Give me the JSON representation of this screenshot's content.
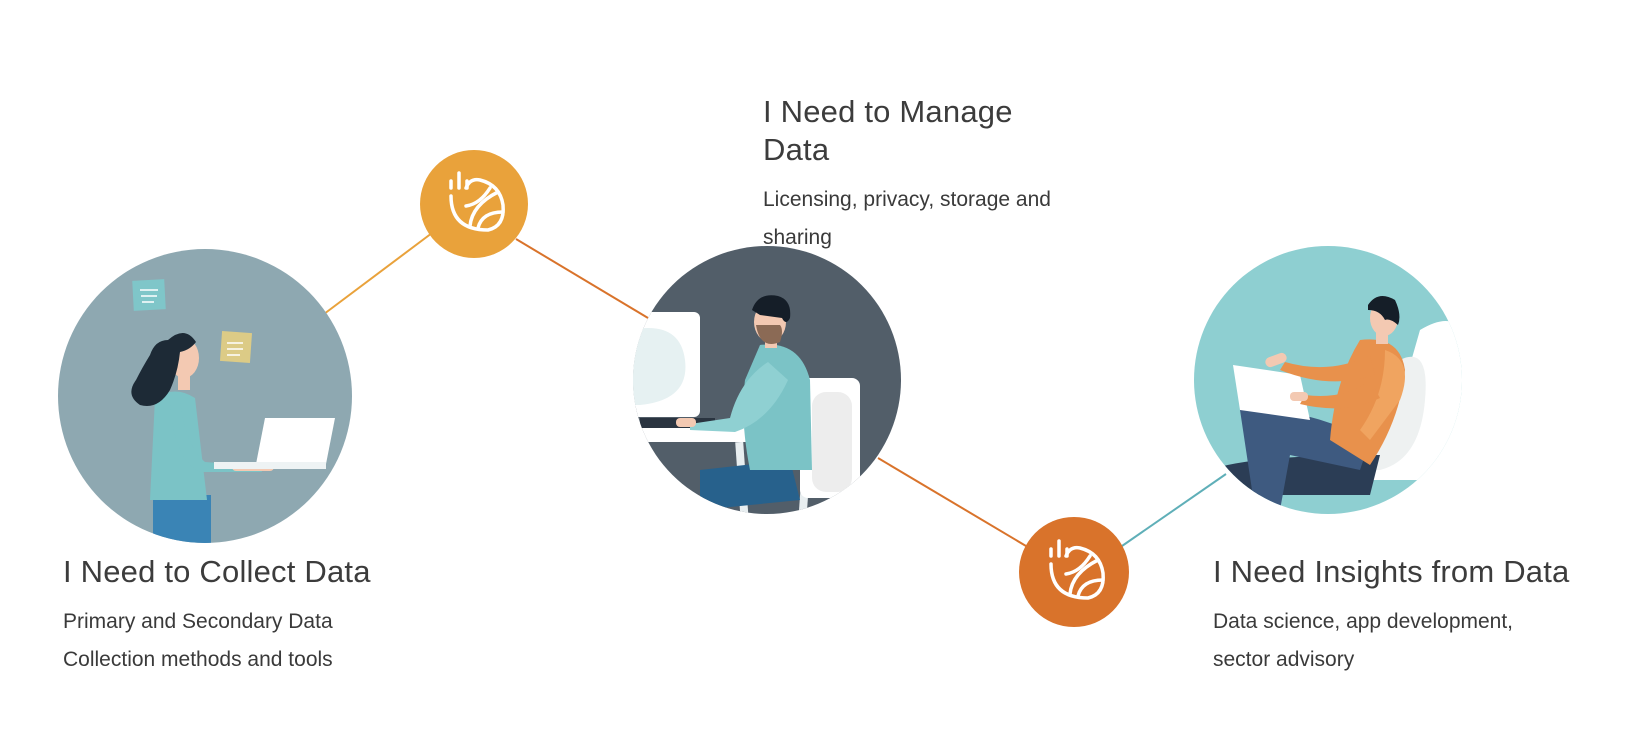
{
  "steps": [
    {
      "title": "I Need to Collect Data",
      "description_line1": "Primary and Secondary Data",
      "description_line2": "Collection methods and tools",
      "illustration": "woman-with-laptop-illustration"
    },
    {
      "title": "I Need to Manage Data",
      "description_line1": "Licensing, privacy, storage and",
      "description_line2": "sharing",
      "illustration": "man-at-desk-computer-illustration"
    },
    {
      "title": "I Need Insights from Data",
      "description_line1": "Data science, app development,",
      "description_line2": "sector advisory",
      "illustration": "man-in-chair-with-tablet-illustration"
    }
  ],
  "connector_icons": [
    {
      "name": "data-leaf-icon",
      "color": "#E9A23B"
    },
    {
      "name": "data-leaf-icon",
      "color": "#D9732B"
    }
  ],
  "colors": {
    "line_orange_light": "#E9A23B",
    "line_orange_dark": "#D9732B",
    "line_teal": "#5FAFB8",
    "circle_grey_blue": "#8EA8B1",
    "circle_slate": "#525E69",
    "circle_teal": "#8ECFD1"
  }
}
